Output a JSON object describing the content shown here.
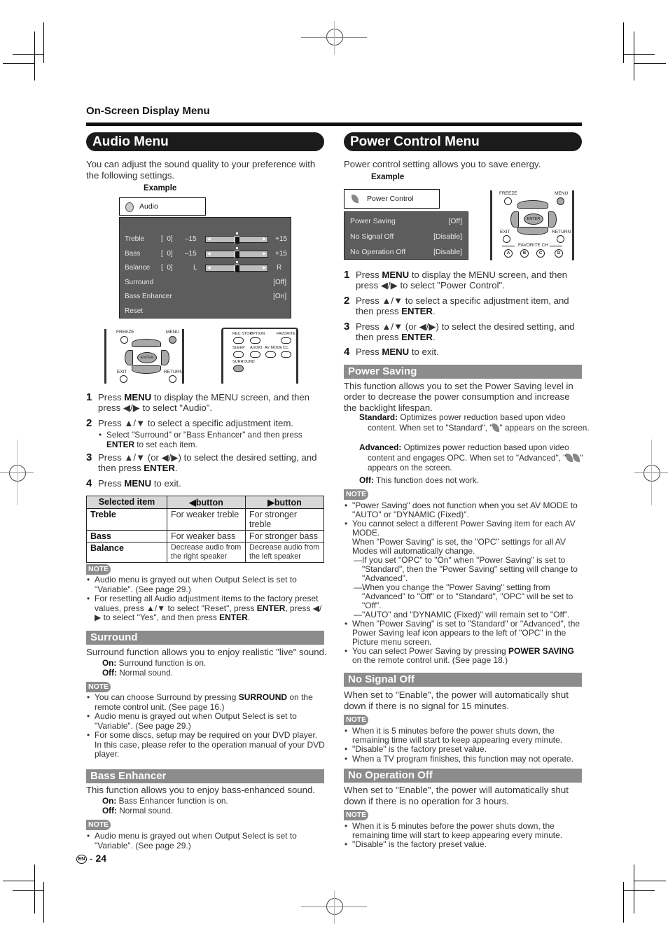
{
  "page": {
    "header": "On-Screen Display Menu",
    "page_number": "24",
    "lang_badge": "EN",
    "page_sep": "-"
  },
  "audio": {
    "title": "Audio Menu",
    "intro": "You can adjust the sound quality to your preference with the following settings.",
    "example_label": "Example",
    "osd_title": "Audio",
    "osd_rows": [
      {
        "label": "Treble",
        "value": "[  0]",
        "min": "–15",
        "max": "+15",
        "level": 0.5
      },
      {
        "label": "Bass",
        "value": "[  0]",
        "min": "–15",
        "max": "+15",
        "level": 0.5
      },
      {
        "label": "Balance",
        "value": "[  0]",
        "min": "L",
        "max": "R",
        "level": 0.5
      },
      {
        "label": "Surround",
        "setting": "[Off]"
      },
      {
        "label": "Bass Enhancer",
        "setting": "[On]"
      },
      {
        "label": "Reset"
      }
    ],
    "remote1": {
      "freeze": "FREEZE",
      "menu": "MENU",
      "enter": "ENTER",
      "exit": "EXIT",
      "return": "RETURN"
    },
    "remote2": {
      "rec_stop": "REC STOP",
      "option": "OPTION",
      "favorite": "FAVORITE",
      "sleep": "SLEEP",
      "audio": "AUDIO",
      "av_mode": "AV MODE",
      "cc": "CC",
      "surround": "SURROUND"
    },
    "steps": [
      {
        "n": "1",
        "html": "Press <b>MENU</b> to display the MENU screen, and then press ◀/▶ to select \"Audio\"."
      },
      {
        "n": "2",
        "html": "Press ▲/▼ to select a specific adjustment item."
      },
      {
        "n": "3",
        "html": "Press ▲/▼ (or ◀/▶) to select the desired setting, and then press <b>ENTER</b>."
      },
      {
        "n": "4",
        "html": "Press <b>MENU</b> to exit."
      }
    ],
    "step2_sub": "Select \"Surround\" or \"Bass Enhancer\" and then press <b>ENTER</b> to set each item.",
    "table": {
      "headers": [
        "Selected item",
        "◀button",
        "▶button"
      ],
      "rows": [
        [
          "Treble",
          "For weaker treble",
          "For stronger treble"
        ],
        [
          "Bass",
          "For weaker bass",
          "For stronger bass"
        ],
        [
          "Balance",
          "Decrease audio from the right speaker",
          "Decrease audio from the left speaker"
        ]
      ]
    },
    "note_label": "NOTE",
    "notes": [
      "Audio menu is grayed out when Output Select is set to \"Variable\". (See page 29.)",
      "For resetting all Audio adjustment items to the factory preset values, press ▲/▼ to select \"Reset\", press <b>ENTER</b>, press ◀/▶ to select \"Yes\", and then press <b>ENTER</b>."
    ],
    "surround": {
      "title": "Surround",
      "desc": "Surround function allows you to enjoy realistic \"live\" sound.",
      "on": "<b>On:</b> Surround function is on.",
      "off": "<b>Off:</b> Normal sound.",
      "notes": [
        "You can choose Surround by pressing <b>SURROUND</b> on the remote control unit. (See page 16.)",
        "Audio menu is grayed out when Output Select is set to \"Variable\". (See page 29.)",
        "For some discs, setup may be required on your DVD player. In this case, please refer to the operation manual of your DVD player."
      ]
    },
    "bass_enhancer": {
      "title": "Bass Enhancer",
      "desc": "This function allows you to enjoy bass-enhanced sound.",
      "on": "<b>On:</b> Bass Enhancer function is on.",
      "off": "<b>Off:</b> Normal sound.",
      "notes": [
        "Audio menu is grayed out when Output Select is set to \"Variable\". (See page 29.)"
      ]
    }
  },
  "power": {
    "title": "Power Control Menu",
    "intro": "Power control setting allows you to save energy.",
    "example_label": "Example",
    "osd_title": "Power Control",
    "osd_rows": [
      {
        "label": "Power Saving",
        "setting": "[Off]"
      },
      {
        "label": "No Signal Off",
        "setting": "[Disable]"
      },
      {
        "label": "No Operation Off",
        "setting": "[Disable]"
      }
    ],
    "remote": {
      "freeze": "FREEZE",
      "menu": "MENU",
      "enter": "ENTER",
      "exit": "EXIT",
      "return": "RETURN",
      "favorite_ch": "FAVORITE CH",
      "a": "A",
      "b": "B",
      "c": "C",
      "d": "D"
    },
    "steps": [
      {
        "n": "1",
        "html": "Press <b>MENU</b> to display the MENU screen, and then press ◀/▶ to select \"Power Control\"."
      },
      {
        "n": "2",
        "html": "Press ▲/▼ to select a specific adjustment item, and then press <b>ENTER</b>."
      },
      {
        "n": "3",
        "html": "Press ▲/▼ (or ◀/▶) to select the desired setting, and then press <b>ENTER</b>."
      },
      {
        "n": "4",
        "html": "Press <b>MENU</b> to exit."
      }
    ],
    "power_saving": {
      "title": "Power Saving",
      "desc": "This function allows you to set the Power Saving level in order to decrease the power consumption and increase the backlight lifespan.",
      "standard": "<b>Standard:</b> Optimizes power reduction based upon video content. When set to \"Standard\", \"<span class='leaf'></span>\" appears on the screen.",
      "advanced": "<b>Advanced:</b> Optimizes power reduction based upon video content and engages OPC. When set to \"Advanced\", \"<span class='leaf'></span><span class='leaf'></span>\" appears on the screen.",
      "off": "<b>Off:</b> This function does not work.",
      "notes": [
        "\"Power Saving\" does not function when you set AV MODE to \"AUTO\" or \"DYNAMIC (Fixed)\".",
        "You cannot select a different Power Saving item for each AV MODE.<br>When \"Power Saving\" is set, the \"OPC\" settings for all AV Modes will automatically change.<span class='dash'>—If you set \"OPC\" to \"On\" when \"Power Saving\" is set to \"Standard\", then the \"Power Saving\" setting will change to \"Advanced\".</span><span class='dash'>—When you change the \"Power Saving\" setting from \"Advanced\" to \"Off\" or to \"Standard\", \"OPC\" will be set to \"Off\".</span><span class='dash'>—\"AUTO\" and \"DYNAMIC (Fixed)\" will remain set to \"Off\".</span>",
        "When \"Power Saving\" is set to \"Standard\" or \"Advanced\", the Power Saving leaf icon appears to the left of \"OPC\" in the Picture menu screen.",
        "You can select Power Saving by pressing <b>POWER SAVING</b> on the remote control unit. (See page 18.)"
      ]
    },
    "no_signal_off": {
      "title": "No Signal Off",
      "desc": "When set to \"Enable\", the power will automatically shut down if there is no signal for 15 minutes.",
      "notes": [
        "When it is 5 minutes before the power shuts down, the remaining time will start to keep appearing every minute.",
        "\"Disable\" is the factory preset value.",
        "When a TV program finishes, this function may not operate."
      ]
    },
    "no_operation_off": {
      "title": "No Operation Off",
      "desc": "When set to \"Enable\", the power will automatically shut down if there is no operation for 3 hours.",
      "notes": [
        "When it is 5 minutes before the power shuts down, the remaining time will start to keep appearing every minute.",
        "\"Disable\" is the factory preset value."
      ]
    }
  }
}
